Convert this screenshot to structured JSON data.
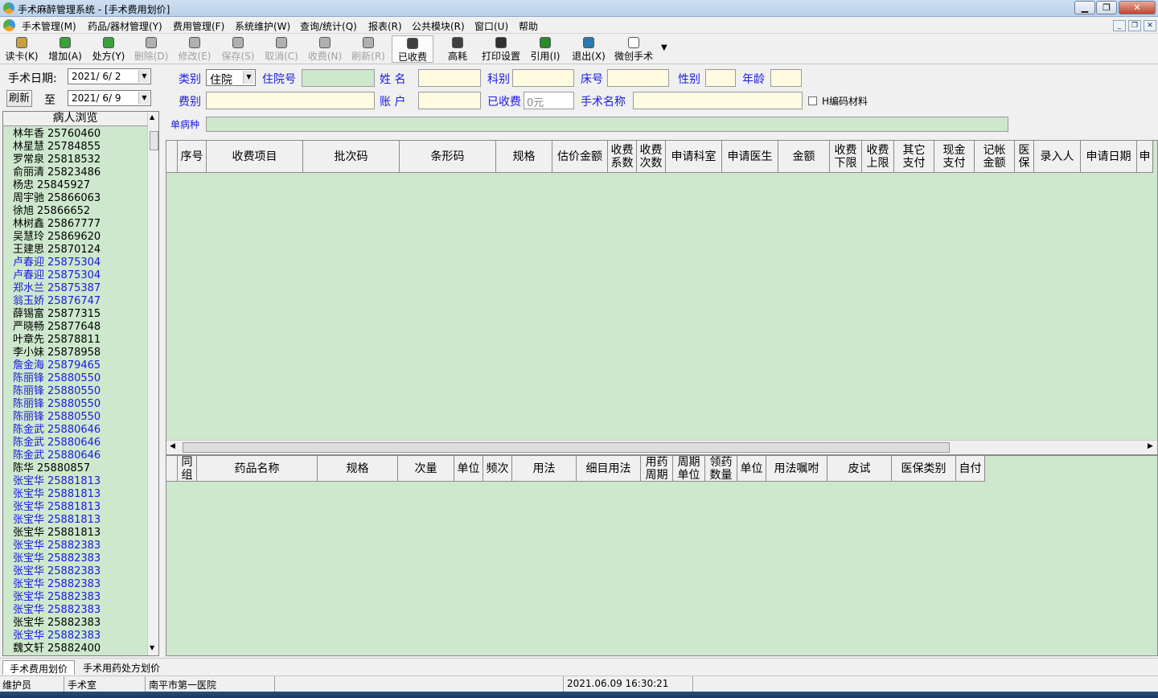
{
  "window": {
    "title": "手术麻醉管理系统 - [手术费用划价]",
    "min_label": "▁",
    "max_label": "❐",
    "close_label": "✕"
  },
  "menu": {
    "items": [
      "手术管理(M)",
      "药品/器材管理(Y)",
      "费用管理(F)",
      "系统维护(W)",
      "查询/统计(Q)",
      "报表(R)",
      "公共模块(R)",
      "窗口(U)",
      "帮助"
    ],
    "mdi_controls": [
      "_",
      "❐",
      "✕"
    ]
  },
  "toolbar": {
    "buttons": [
      {
        "label": "读卡(K)",
        "icon": "read-card-icon",
        "color": "#c8a040",
        "enabled": true
      },
      {
        "label": "增加(A)",
        "icon": "add-icon",
        "color": "#3aa03a",
        "enabled": true
      },
      {
        "label": "处方(Y)",
        "icon": "prescription-icon",
        "color": "#3aa03a",
        "enabled": true
      },
      {
        "label": "删除(D)",
        "icon": "delete-icon",
        "color": "#b0b0b0",
        "enabled": false
      },
      {
        "label": "修改(E)",
        "icon": "edit-icon",
        "color": "#b0b0b0",
        "enabled": false
      },
      {
        "label": "保存(S)",
        "icon": "save-icon",
        "color": "#b0b0b0",
        "enabled": false
      },
      {
        "label": "取消(C)",
        "icon": "cancel-icon",
        "color": "#b0b0b0",
        "enabled": false
      },
      {
        "label": "收费(N)",
        "icon": "charge-icon",
        "color": "#b0b0b0",
        "enabled": false
      },
      {
        "label": "刷新(R)",
        "icon": "refresh-icon",
        "color": "#b0b0b0",
        "enabled": false
      },
      {
        "label": "已收费",
        "icon": "charged-icon",
        "color": "#404040",
        "enabled": true,
        "pressed": true
      },
      {
        "label": "高耗",
        "icon": "high-consumption-icon",
        "color": "#404040",
        "enabled": true
      },
      {
        "label": "打印设置",
        "icon": "printer-icon",
        "color": "#303030",
        "enabled": true
      },
      {
        "label": "引用(I)",
        "icon": "quote-icon",
        "color": "#2a8a2a",
        "enabled": true
      },
      {
        "label": "退出(X)",
        "icon": "exit-icon",
        "color": "#2a7ab0",
        "enabled": true
      },
      {
        "label": "微创手术",
        "icon": "document-icon",
        "color": "#ffffff",
        "enabled": true
      }
    ],
    "more_arrow": "▼"
  },
  "filter": {
    "date_label": "手术日期:",
    "date_from": "2021/ 6/ 2",
    "refresh_label": "刷新",
    "to_label": "至",
    "date_to": "2021/ 6/ 9"
  },
  "patients": {
    "header": "病人浏览",
    "rows": [
      {
        "name": "林年香",
        "id": "25760460",
        "blue": false
      },
      {
        "name": "林星慧",
        "id": "25784855",
        "blue": false
      },
      {
        "name": "罗常泉",
        "id": "25818532",
        "blue": false
      },
      {
        "name": "俞丽清",
        "id": "25823486",
        "blue": false
      },
      {
        "name": "杨忠",
        "id": "25845927",
        "blue": false
      },
      {
        "name": "周宇驰",
        "id": "25866063",
        "blue": false
      },
      {
        "name": "徐旭",
        "id": "25866652",
        "blue": false
      },
      {
        "name": "林树鑫",
        "id": "25867777",
        "blue": false
      },
      {
        "name": "吴慧玲",
        "id": "25869620",
        "blue": false
      },
      {
        "name": "王建思",
        "id": "25870124",
        "blue": false
      },
      {
        "name": "卢春迎",
        "id": "25875304",
        "blue": true
      },
      {
        "name": "卢春迎",
        "id": "25875304",
        "blue": true
      },
      {
        "name": "郑水兰",
        "id": "25875387",
        "blue": true
      },
      {
        "name": "翁玉娇",
        "id": "25876747",
        "blue": true
      },
      {
        "name": "薛锡富",
        "id": "25877315",
        "blue": false
      },
      {
        "name": "严晓畅",
        "id": "25877648",
        "blue": false
      },
      {
        "name": "叶章先",
        "id": "25878811",
        "blue": false
      },
      {
        "name": "李小妹",
        "id": "25878958",
        "blue": false
      },
      {
        "name": "詹金海",
        "id": "25879465",
        "blue": true
      },
      {
        "name": "陈丽锋",
        "id": "25880550",
        "blue": true
      },
      {
        "name": "陈丽锋",
        "id": "25880550",
        "blue": true
      },
      {
        "name": "陈丽锋",
        "id": "25880550",
        "blue": true
      },
      {
        "name": "陈丽锋",
        "id": "25880550",
        "blue": true
      },
      {
        "name": "陈金武",
        "id": "25880646",
        "blue": true
      },
      {
        "name": "陈金武",
        "id": "25880646",
        "blue": true
      },
      {
        "name": "陈金武",
        "id": "25880646",
        "blue": true
      },
      {
        "name": "陈华",
        "id": "25880857",
        "blue": false
      },
      {
        "name": "张宝华",
        "id": "25881813",
        "blue": true
      },
      {
        "name": "张宝华",
        "id": "25881813",
        "blue": true
      },
      {
        "name": "张宝华",
        "id": "25881813",
        "blue": true
      },
      {
        "name": "张宝华",
        "id": "25881813",
        "blue": true
      },
      {
        "name": "张宝华",
        "id": "25881813",
        "blue": false
      },
      {
        "name": "张宝华",
        "id": "25882383",
        "blue": true
      },
      {
        "name": "张宝华",
        "id": "25882383",
        "blue": true
      },
      {
        "name": "张宝华",
        "id": "25882383",
        "blue": true
      },
      {
        "name": "张宝华",
        "id": "25882383",
        "blue": true
      },
      {
        "name": "张宝华",
        "id": "25882383",
        "blue": true
      },
      {
        "name": "张宝华",
        "id": "25882383",
        "blue": true
      },
      {
        "name": "张宝华",
        "id": "25882383",
        "blue": false
      },
      {
        "name": "张宝华",
        "id": "25882383",
        "blue": true
      },
      {
        "name": "魏文轩",
        "id": "25882400",
        "blue": false
      }
    ]
  },
  "form": {
    "category_label": "类别",
    "category_value": "住院",
    "inpatient_no_label": "住院号",
    "inpatient_no_value": "",
    "name_label": "姓 名",
    "name_value": "",
    "dept_label": "科别",
    "dept_value": "",
    "bed_label": "床号",
    "bed_value": "",
    "sex_label": "性别",
    "sex_value": "",
    "age_label": "年龄",
    "age_value": "",
    "fee_type_label": "费别",
    "fee_type_value": "",
    "account_label": "账 户",
    "account_value": "",
    "charged_label": "已收费",
    "charged_value": "0元",
    "surgery_name_label": "手术名称",
    "surgery_name_value": "",
    "h_code_label": "H编码材料",
    "single_disease_label": "单病种",
    "single_disease_value": ""
  },
  "fee_grid": {
    "columns": [
      "序号",
      "收费项目",
      "批次码",
      "条形码",
      "规格",
      "估价金额",
      "收费\n系数",
      "收费\n次数",
      "申请科室",
      "申请医生",
      "金额",
      "收费\n下限",
      "收费\n上限",
      "其它\n支付",
      "现金\n支付",
      "记帐\n金额",
      "医\n保",
      "录入人",
      "申请日期",
      "申"
    ]
  },
  "drug_grid": {
    "columns": [
      "同\n组",
      "药品名称",
      "规格",
      "次量",
      "单位",
      "频次",
      "用法",
      "细目用法",
      "用药\n周期",
      "周期\n单位",
      "领药\n数量",
      "单位",
      "用法嘱咐",
      "皮试",
      "医保类别",
      "自付"
    ]
  },
  "tabs": [
    "手术费用划价",
    "手术用药处方划价"
  ],
  "status": {
    "user": "维护员",
    "room": "手术室",
    "hospital": "南平市第一医院",
    "blank": "",
    "datetime": "2021.06.09 16:30:21"
  }
}
